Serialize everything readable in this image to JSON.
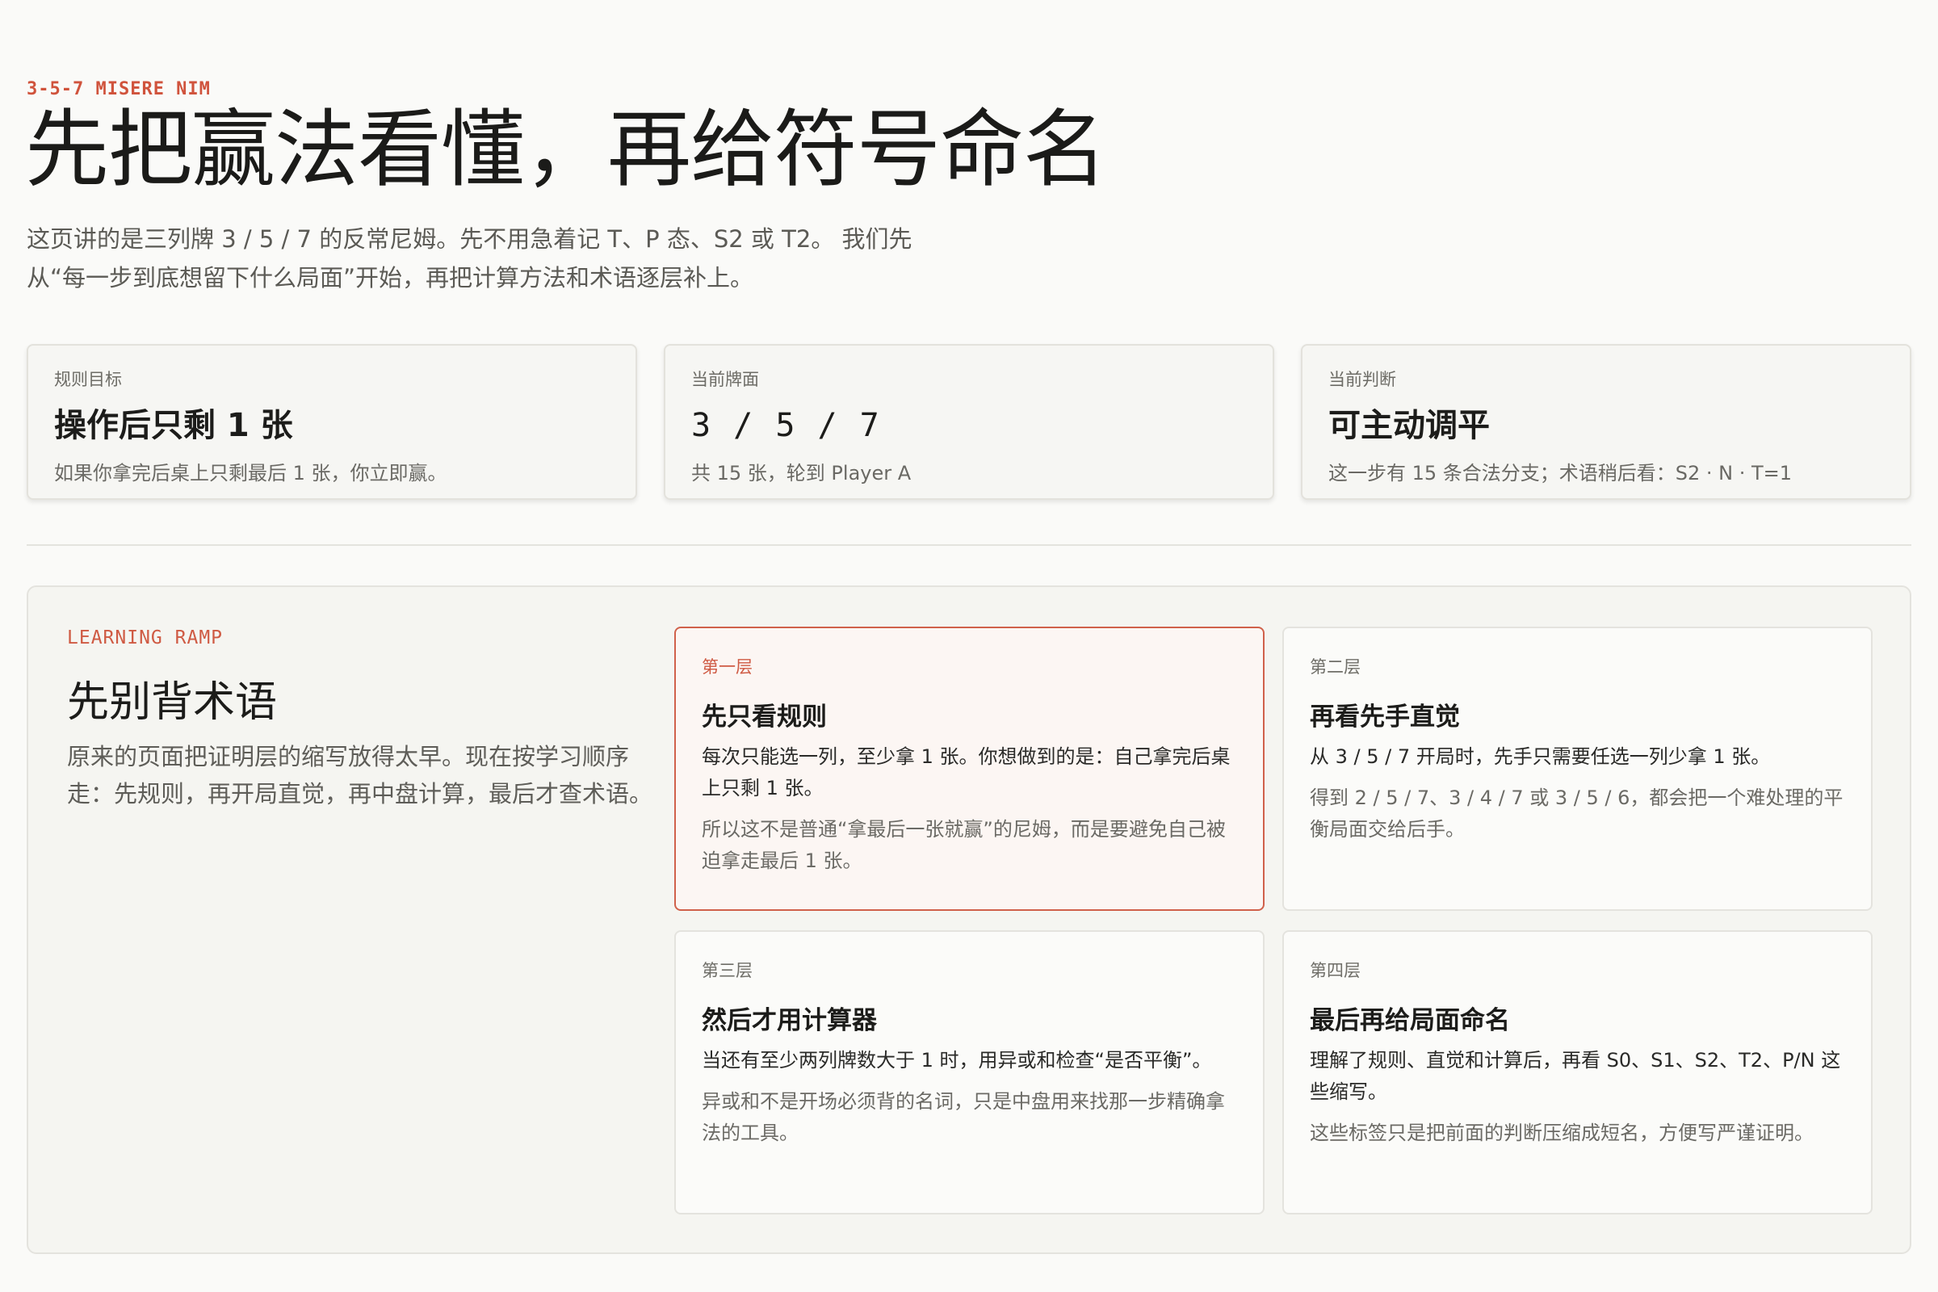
{
  "header": {
    "eyebrow": "3-5-7 MISERE NIM",
    "title": "先把赢法看懂，再给符号命名",
    "lead": "这页讲的是三列牌 3 / 5 / 7 的反常尼姆。先不用急着记 T、P 态、S2 或 T2。 我们先从“每一步到底想留下什么局面”开始，再把计算方法和术语逐层补上。"
  },
  "stats": [
    {
      "label": "规则目标",
      "value": "操作后只剩 1 张",
      "note": "如果你拿完后桌上只剩最后 1 张，你立即赢。"
    },
    {
      "label": "当前牌面",
      "value": "3 / 5 / 7",
      "note": "共 15 张，轮到 Player A"
    },
    {
      "label": "当前判断",
      "value": "可主动调平",
      "note": "这一步有 15 条合法分支；术语稍后看：S2 · N · T=1"
    }
  ],
  "ramp": {
    "eyebrow": "LEARNING RAMP",
    "title": "先别背术语",
    "lead": "原来的页面把证明层的缩写放得太早。现在按学习顺序走：先规则，再开局直觉，再中盘计算，最后才查术语。",
    "cards": [
      {
        "step": "第一层",
        "title": "先只看规则",
        "body": "每次只能选一列，至少拿 1 张。你想做到的是：自己拿完后桌上只剩 1 张。",
        "note": "所以这不是普通“拿最后一张就赢”的尼姆，而是要避免自己被迫拿走最后 1 张。"
      },
      {
        "step": "第二层",
        "title": "再看先手直觉",
        "body": "从 3 / 5 / 7 开局时，先手只需要任选一列少拿 1 张。",
        "note": "得到 2 / 5 / 7、3 / 4 / 7 或 3 / 5 / 6，都会把一个难处理的平衡局面交给后手。"
      },
      {
        "step": "第三层",
        "title": "然后才用计算器",
        "body": "当还有至少两列牌数大于 1 时，用异或和检查“是否平衡”。",
        "note": "异或和不是开场必须背的名词，只是中盘用来找那一步精确拿法的工具。"
      },
      {
        "step": "第四层",
        "title": "最后再给局面命名",
        "body": "理解了规则、直觉和计算后，再看 S0、S1、S2、T2、P/N 这些缩写。",
        "note": "这些标签只是把前面的判断压缩成短名，方便写严谨证明。"
      }
    ]
  }
}
